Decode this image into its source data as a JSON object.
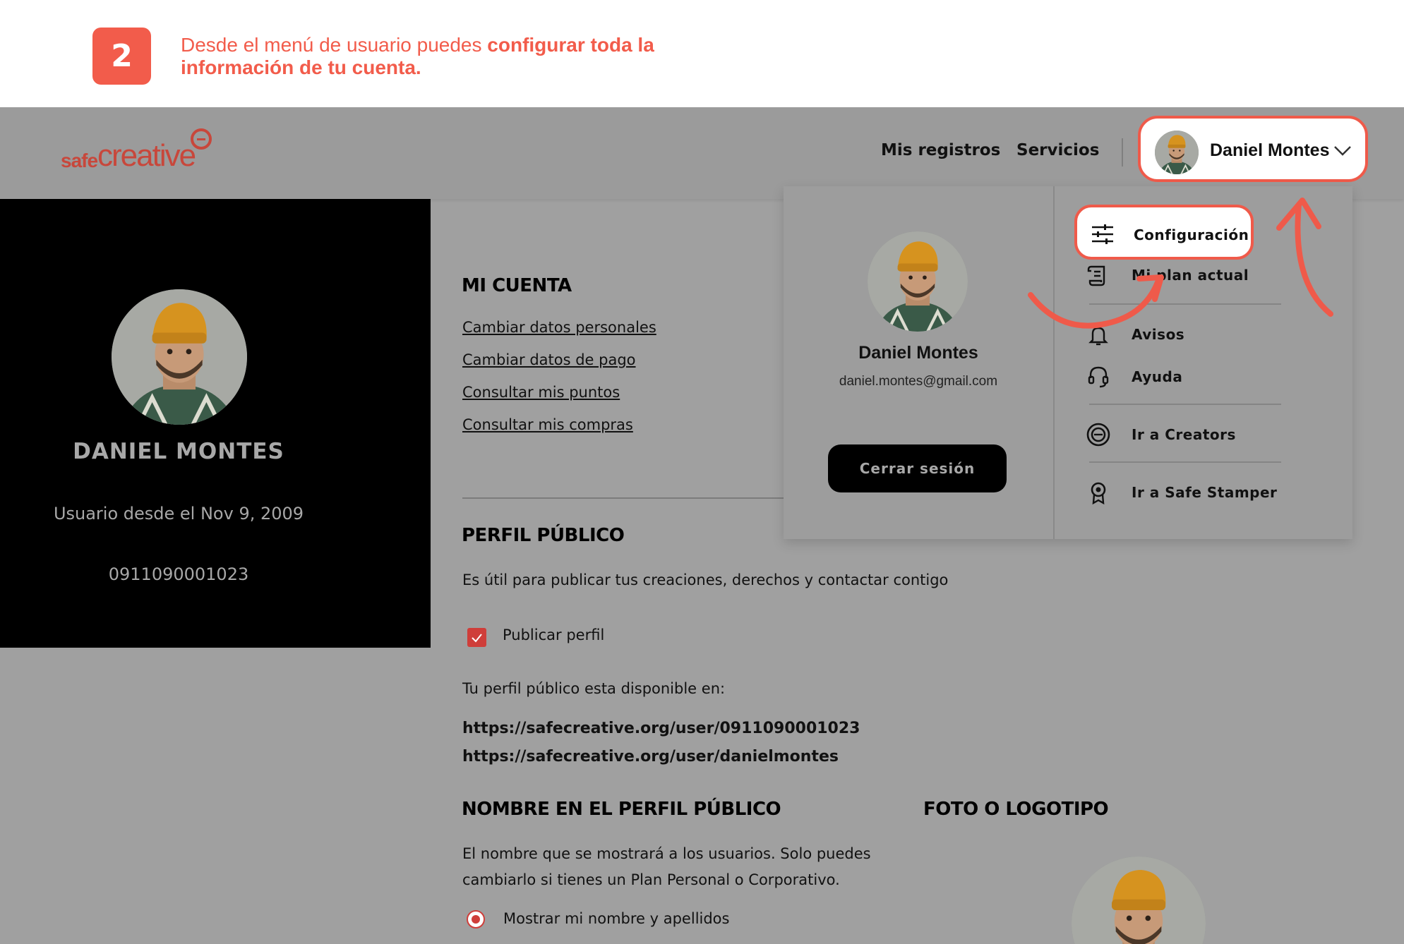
{
  "banner": {
    "step_number": "2",
    "text_normal": "Desde el menú de usuario puedes ",
    "text_bold": "configurar toda la información de tu cuenta."
  },
  "header": {
    "logo_small": "safe",
    "logo_large": "creative",
    "nav": [
      "Mis registros",
      "Servicios"
    ],
    "user_name": "Daniel Montes"
  },
  "profile_sidebar": {
    "name": "DANIEL MONTES",
    "since": "Usuario desde el Nov 9, 2009",
    "id": "0911090001023"
  },
  "account": {
    "title": "MI CUENTA",
    "links": [
      "Cambiar datos personales",
      "Cambiar datos de pago",
      "Consultar mis puntos",
      "Consultar mis compras"
    ]
  },
  "public_profile": {
    "title": "PERFIL PÚBLICO",
    "description": "Es útil para publicar tus creaciones, derechos y contactar contigo",
    "publish_label": "Publicar perfil",
    "publish_checked": true,
    "available_text": "Tu perfil público esta disponible en:",
    "urls": [
      "https://safecreative.org/user/0911090001023",
      "https://safecreative.org/user/danielmontes"
    ]
  },
  "public_name": {
    "title": "NOMBRE EN EL PERFIL PÚBLICO",
    "description_line1": "El nombre que se mostrará a los usuarios. Solo puedes",
    "description_line2": "cambiarlo si tienes un Plan Personal o Corporativo.",
    "option_label": "Mostrar mi nombre y apellidos"
  },
  "photo": {
    "title": "FOTO O LOGOTIPO"
  },
  "dropdown": {
    "name": "Daniel Montes",
    "email": "daniel.montes@gmail.com",
    "logout_label": "Cerrar sesión",
    "items": [
      {
        "label": "Configuración",
        "icon": "sliders-icon"
      },
      {
        "label": "Mi plan actual",
        "icon": "scroll-icon"
      },
      {
        "label": "Avisos",
        "icon": "bell-icon"
      },
      {
        "label": "Ayuda",
        "icon": "headset-icon"
      },
      {
        "label": "Ir a Creators",
        "icon": "creators-icon"
      },
      {
        "label": "Ir a Safe Stamper",
        "icon": "badge-icon"
      }
    ]
  },
  "colors": {
    "accent": "#f25c4b",
    "overlay_gray": "#a0a0a0",
    "checkbox_red": "#cf3e3a"
  }
}
